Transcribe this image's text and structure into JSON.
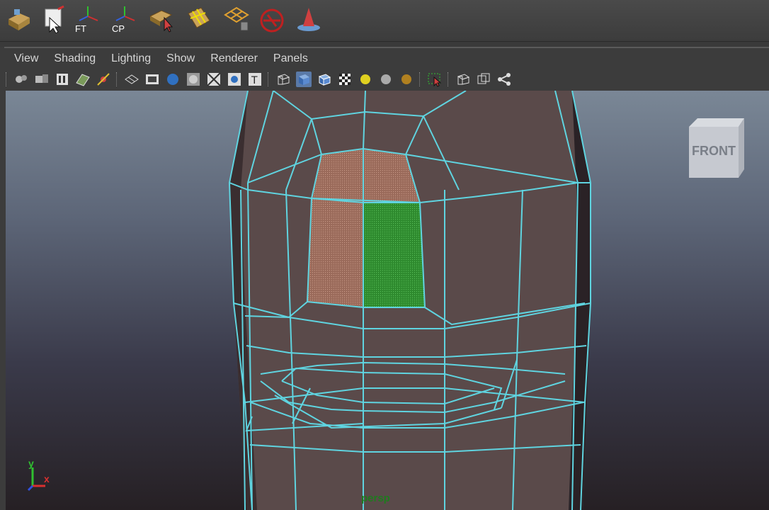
{
  "shelf": {
    "buttons": [
      {
        "icon": "poly-cube-select-icon"
      },
      {
        "icon": "paint-select-icon"
      },
      {
        "icon": "freeze-transform-icon",
        "label": "FT"
      },
      {
        "icon": "center-pivot-icon",
        "label": "CP"
      },
      {
        "icon": "face-select-tool-icon"
      },
      {
        "icon": "grid-layout-icon"
      },
      {
        "icon": "lattice-delete-icon"
      },
      {
        "icon": "cancel-tool-icon"
      },
      {
        "icon": "cone-arrow-icon"
      }
    ]
  },
  "menu": {
    "view": "View",
    "shading": "Shading",
    "lighting": "Lighting",
    "show": "Show",
    "renderer": "Renderer",
    "panels": "Panels"
  },
  "viewcube": {
    "label": "FRONT"
  },
  "viewport": {
    "camera": "persp"
  },
  "axis": {
    "x": "x",
    "y": "y"
  },
  "colors": {
    "wire": "#5fd4e0",
    "mesh_fill": "#5a4a4a",
    "face_selected": "#3a8a3a",
    "face_highlight": "#9a6a5a"
  }
}
